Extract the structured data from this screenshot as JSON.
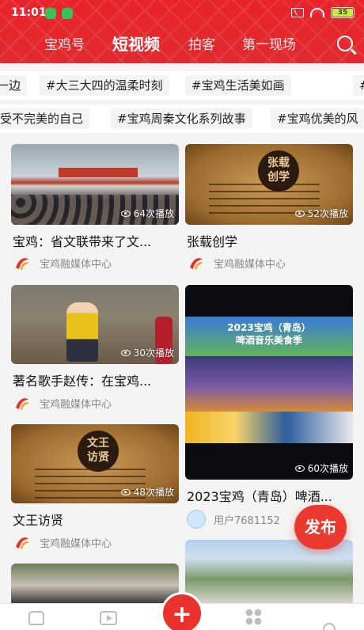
{
  "status_bar": {
    "time": "11:01",
    "battery": "35"
  },
  "nav": {
    "tabs": [
      "宝鸡号",
      "短视频",
      "拍客",
      "第一现场"
    ],
    "active": "短视频"
  },
  "hashtags_row1": [
    "#",
    "#大三大四的温柔时刻",
    "#宝鸡生活美如画",
    "#"
  ],
  "hashtags_row1_lead": "一边",
  "hashtags_row2_lead": "受不完美的自己",
  "hashtags_row2": [
    "#宝鸡周秦文化系列故事",
    "#宝鸡优美的风"
  ],
  "feed": {
    "left": [
      {
        "title": "宝鸡：省文联带来了文...",
        "plays": "64次播放",
        "author": "宝鸡融媒体中心"
      },
      {
        "title": "著名歌手赵传：在宝鸡...",
        "plays": "30次播放",
        "author": "宝鸡融媒体中心"
      },
      {
        "title": "文王访贤",
        "plays": "48次播放",
        "author": "宝鸡融媒体中心",
        "stamp": "文王\n访贤"
      }
    ],
    "right": [
      {
        "title": "张载创学",
        "plays": "52次播放",
        "author": "宝鸡融媒体中心",
        "stamp": "张载\n创学"
      },
      {
        "title": "2023宝鸡（青岛）啤酒...",
        "plays": "60次播放",
        "author": "用户7681152",
        "poster_text": "2023宝鸡（青岛）\n啤酒音乐美食季"
      }
    ]
  },
  "publish_label": "发布",
  "add_label": "+",
  "colors": {
    "brand_red": "#e8232b",
    "publish_red": "#ea3a30"
  }
}
